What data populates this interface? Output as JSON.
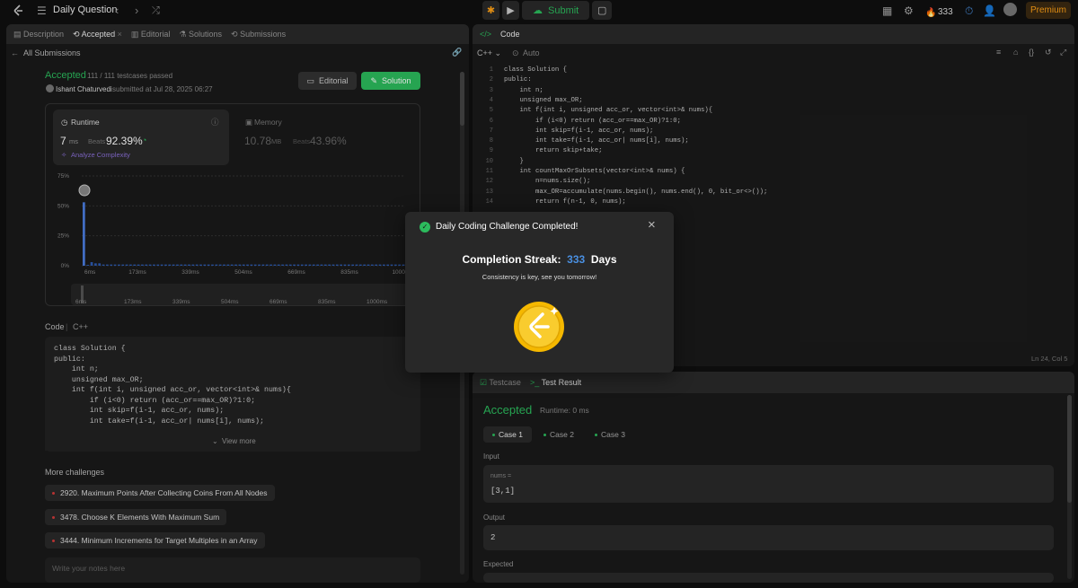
{
  "topbar": {
    "title": "Daily Question",
    "submit": "Submit",
    "streak_count": "333",
    "premium": "Premium"
  },
  "left_tabs": [
    "Description",
    "Accepted",
    "Editorial",
    "Solutions",
    "Submissions"
  ],
  "all_submissions": "All Submissions",
  "result": {
    "status": "Accepted",
    "testcases": "111 / 111 testcases passed",
    "user": "Ishant Chaturvedi",
    "submitted": "submitted at Jul 28, 2025 06:27",
    "editorial_btn": "Editorial",
    "solution_btn": "Solution"
  },
  "runtime": {
    "label": "Runtime",
    "value": "7",
    "unit": "ms",
    "beats_label": "Beats",
    "beats": "92.39%",
    "analyze": "Analyze Complexity"
  },
  "memory": {
    "label": "Memory",
    "value": "10.78",
    "unit": "MB",
    "beats_label": "Beats",
    "beats": "43.96%"
  },
  "chart_data": {
    "type": "bar",
    "title": "",
    "y_ticks": [
      "75%",
      "50%",
      "25%",
      "0%"
    ],
    "x_ticks": [
      "6ms",
      "173ms",
      "339ms",
      "504ms",
      "669ms",
      "835ms",
      "1000ms"
    ],
    "values": [
      53,
      0,
      3,
      2,
      2,
      1,
      1,
      1,
      1,
      1,
      1,
      1,
      1,
      1,
      1,
      1,
      1,
      1,
      1,
      1,
      1,
      1,
      1,
      1,
      1,
      1,
      1,
      1,
      1,
      1,
      1,
      1,
      1,
      1,
      1,
      1,
      1,
      1,
      1,
      1,
      1,
      1,
      1,
      1,
      1,
      1,
      1,
      1,
      1,
      1,
      1,
      1,
      1,
      1,
      1,
      1,
      1,
      1,
      1,
      1,
      1,
      1,
      1,
      1,
      1,
      1,
      1,
      1,
      1,
      1,
      1,
      1,
      1,
      1,
      1,
      1,
      1,
      1,
      1,
      1,
      1,
      1,
      1
    ],
    "ylim": [
      0,
      75
    ]
  },
  "mini_axis": [
    "6ms",
    "173ms",
    "339ms",
    "504ms",
    "669ms",
    "835ms",
    "1000ms"
  ],
  "code_section": {
    "label": "Code",
    "lang": "C++",
    "view_more": "View more"
  },
  "code_preview": [
    "class Solution {",
    "public:",
    "    int n;",
    "    unsigned max_OR;",
    "    int f(int i, unsigned acc_or, vector<int>& nums){",
    "        if (i<0) return (acc_or==max_OR)?1:0;",
    "        int skip=f(i-1, acc_or, nums);",
    "        int take=f(i-1, acc_or| nums[i], nums);"
  ],
  "more_challenges": {
    "title": "More challenges",
    "items": [
      "2920. Maximum Points After Collecting Coins From All Nodes",
      "3478. Choose K Elements With Maximum Sum",
      "3444. Minimum Increments for Target Multiples in an Array"
    ]
  },
  "notes_placeholder": "Write your notes here",
  "editor": {
    "title": "Code",
    "lang": "C++",
    "mode": "Auto",
    "status": "Ln 24, Col 5",
    "lines": [
      "class Solution {",
      "public:",
      "    int n;",
      "    unsigned max_OR;",
      "    int f(int i, unsigned acc_or, vector<int>& nums){",
      "        if (i<0) return (acc_or==max_OR)?1:0;",
      "        int skip=f(i-1, acc_or, nums);",
      "        int take=f(i-1, acc_or| nums[i], nums);",
      "        return skip+take;",
      "    }",
      "    int countMaxOrSubsets(vector<int>& nums) {",
      "        n=nums.size();",
      "        max_OR=accumulate(nums.begin(), nums.end(), 0, bit_or<>());",
      "        return f(n-1, 0, nums);"
    ],
    "line_numbers": [
      "1",
      "2",
      "3",
      "4",
      "5",
      "6",
      "7",
      "8",
      "9",
      "10",
      "11",
      "12",
      "13",
      "14"
    ]
  },
  "test": {
    "tab_testcase": "Testcase",
    "tab_result": "Test Result",
    "status": "Accepted",
    "runtime": "Runtime: 0 ms",
    "cases": [
      "Case 1",
      "Case 2",
      "Case 3"
    ],
    "input_label": "Input",
    "var_name": "nums =",
    "input_value": "[3,1]",
    "output_label": "Output",
    "output_value": "2",
    "expected_label": "Expected"
  },
  "modal": {
    "title": "Daily Coding Challenge Completed!",
    "streak_prefix": "Completion Streak:",
    "streak_value": "333",
    "streak_suffix": "Days",
    "subtitle": "Consistency is key, see you tomorrow!"
  },
  "colors": {
    "accent_green": "#2cbb5d",
    "orange": "#ffa116",
    "blue": "#4a90e2"
  }
}
